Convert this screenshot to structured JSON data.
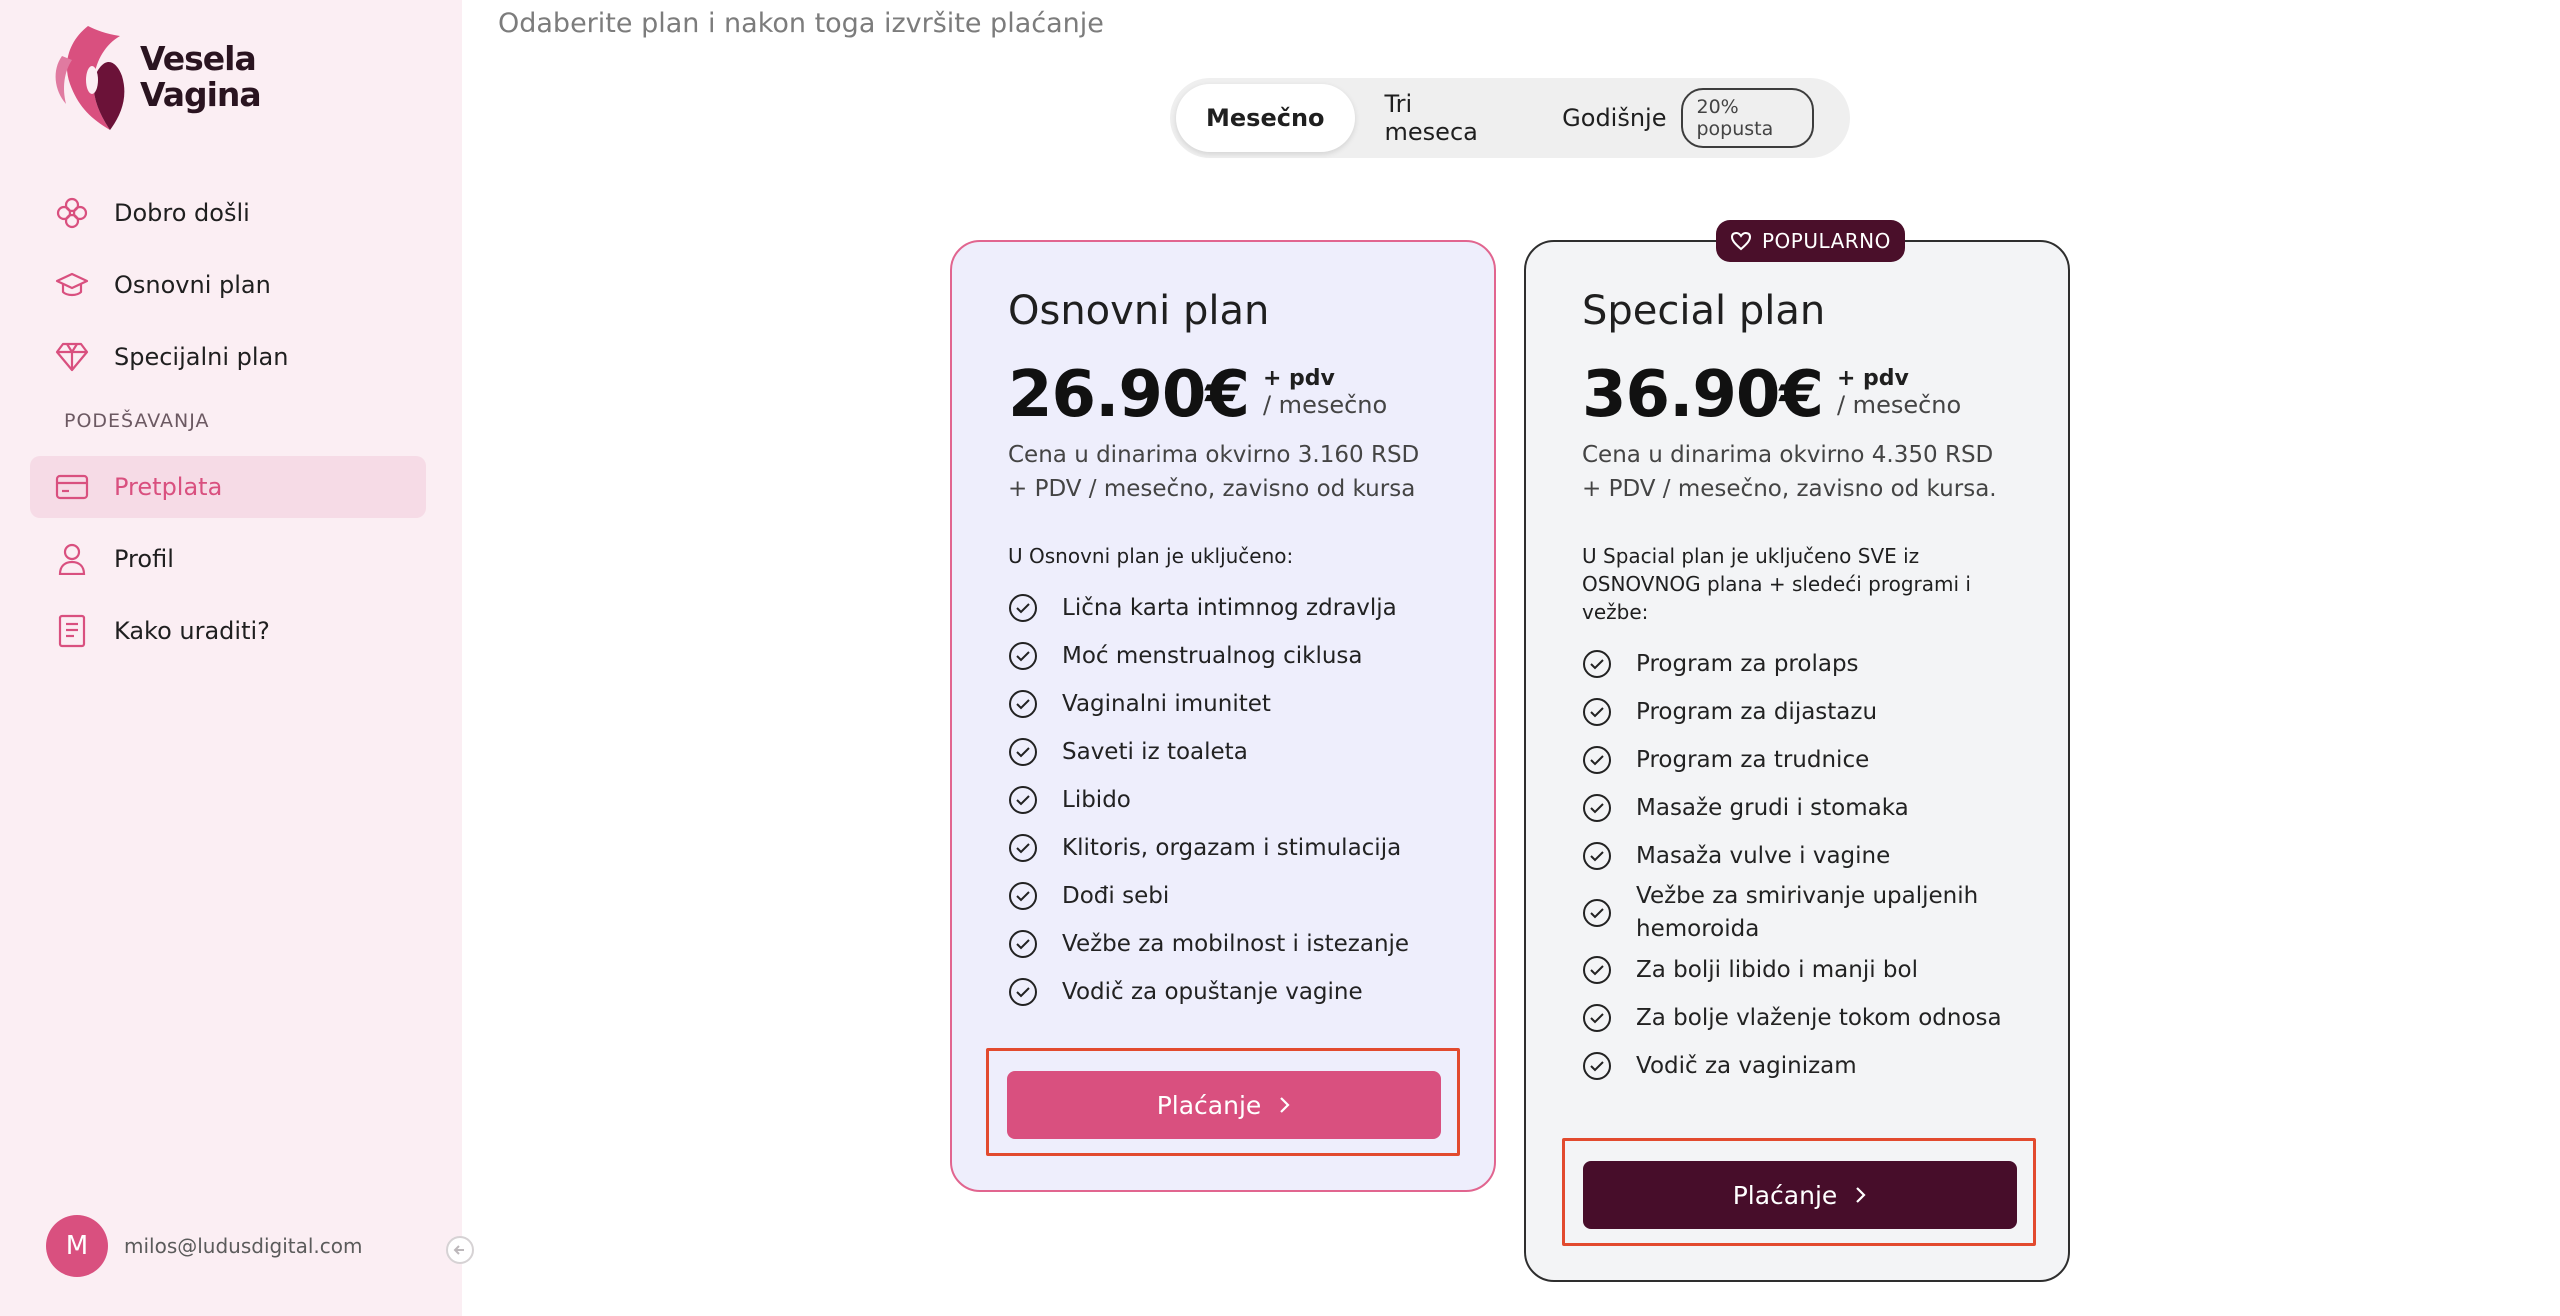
{
  "sidebar": {
    "logo": {
      "line1": "Vesela",
      "line2": "Vagina"
    },
    "items": [
      {
        "label": "Dobro došli",
        "icon": "flower-icon"
      },
      {
        "label": "Osnovni plan",
        "icon": "graduation-cap-icon"
      },
      {
        "label": "Specijalni plan",
        "icon": "diamond-icon"
      }
    ],
    "section_label": "PODEŠAVANJA",
    "settings_items": [
      {
        "label": "Pretplata",
        "icon": "credit-card-icon",
        "active": true
      },
      {
        "label": "Profil",
        "icon": "user-icon"
      },
      {
        "label": "Kako uraditi?",
        "icon": "document-icon"
      }
    ],
    "user": {
      "initial": "M",
      "email": "milos@ludusdigital.com"
    }
  },
  "main": {
    "subtitle": "Odaberite plan i nakon toga izvršite plaćanje",
    "billing": {
      "options": [
        "Mesečno",
        "Tri meseca",
        "Godišnje"
      ],
      "selected": "Mesečno",
      "discount_badge": "20% popusta"
    },
    "plans": [
      {
        "name": "Osnovni plan",
        "price": "26.90€",
        "pdv": "+ pdv",
        "period": "/ mesečno",
        "note": "Cena u dinarima okvirno 3.160 RSD + PDV / mesečno, zavisno od kursa",
        "included_title": "U Osnovni plan je uključeno:",
        "features": [
          "Lična karta intimnog zdravlja",
          "Moć menstrualnog ciklusa",
          "Vaginalni imunitet",
          "Saveti iz toaleta",
          "Libido",
          "Klitoris, orgazam i stimulacija",
          "Dođi sebi",
          "Vežbe za mobilnost i istezanje",
          "Vodič za opuštanje vagine"
        ],
        "button": "Plaćanje"
      },
      {
        "name": "Special plan",
        "badge": "POPULARNO",
        "price": "36.90€",
        "pdv": "+ pdv",
        "period": "/ mesečno",
        "note": "Cena u dinarima okvirno 4.350 RSD + PDV / mesečno, zavisno od kursa.",
        "included_title": "U Spacial plan je uključeno SVE iz OSNOVNOG plana + sledeći programi i vežbe:",
        "features": [
          "Program za prolaps",
          "Program za dijastazu",
          "Program za trudnice",
          "Masaže grudi i stomaka",
          "Masaža vulve i vagine",
          "Vežbe za smirivanje upaljenih hemoroida",
          "Za bolji libido i manji bol",
          "Za bolje vlaženje tokom odnosa",
          "Vodič za vaginizam"
        ],
        "button": "Plaćanje"
      }
    ]
  },
  "colors": {
    "brand_pink": "#d9507f",
    "brand_dark": "#470d2a",
    "highlight_red": "#e24a2e"
  }
}
